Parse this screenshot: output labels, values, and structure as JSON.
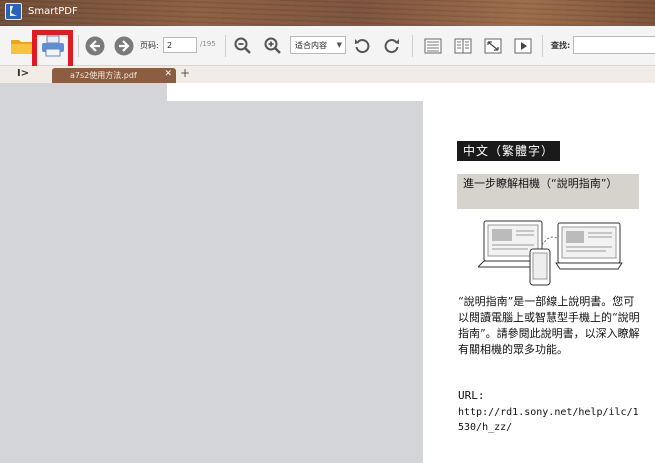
{
  "app": {
    "title": "SmartPDF"
  },
  "toolbar": {
    "open_icon": "folder-icon",
    "print_icon": "printer-icon",
    "prev_icon": "arrow-left-circle-icon",
    "next_icon": "arrow-right-circle-icon",
    "page_label": "页码:",
    "page_value": "2",
    "page_total": "/195",
    "zoom_out_icon": "zoom-out-icon",
    "zoom_in_icon": "zoom-in-icon",
    "fit_mode": "适合内容",
    "rotate_left_icon": "rotate-ccw-icon",
    "rotate_right_icon": "rotate-cw-icon",
    "find_label": "查找:",
    "find_value": ""
  },
  "tabs": {
    "items": [
      {
        "label": "a7s2使用方法.pdf"
      }
    ],
    "new_tab": "+",
    "sidebar_toggle": "I>"
  },
  "document": {
    "lang_heading": "中文（繁體字）",
    "sub_heading": "進一步瞭解相機（“說明指南”）",
    "body": "“說明指南”是一部線上說明書。您可以閱讀電腦上或智慧型手機上的“說明指南”。請參閱此說明書，以深入瞭解有關相機的眾多功能。",
    "url_label": "URL:",
    "url": "http://rd1.sony.net/help/ilc/1530/h_zz/"
  },
  "colors": {
    "highlight": "#e01b24",
    "tab": "#8b5d41",
    "accent_blue": "#2b63b8"
  }
}
